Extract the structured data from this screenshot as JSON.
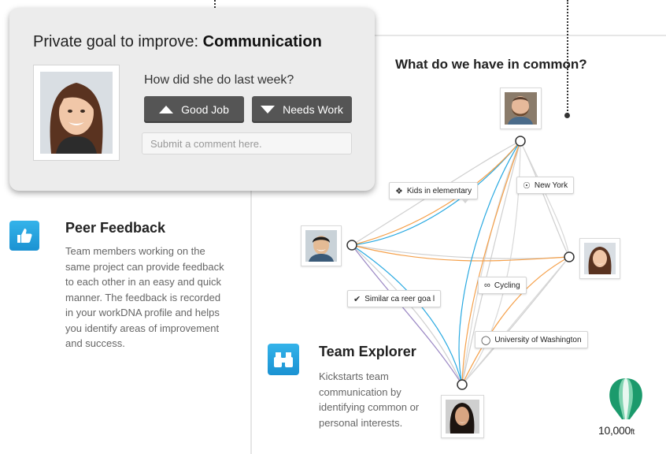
{
  "feedback_card": {
    "title_prefix": "Private goal to improve:",
    "goal": "Communication",
    "question": "How did she do last week?",
    "good_label": "Good Job",
    "needs_label": "Needs Work",
    "comment_placeholder": "Submit a comment here."
  },
  "peer_feedback": {
    "title": "Peer Feedback",
    "description": "Team members working on the same project can provide feedback to each other in an easy and quick manner. The feedback is recorded in your workDNA profile and helps you identify areas of improvement and success."
  },
  "network": {
    "title": "What do we have in common?",
    "tags": {
      "kids": "Kids in elementary",
      "newyork": "New York",
      "cycling": "Cycling",
      "career": "Similar ca reer goa l",
      "uw": "University of Washington"
    }
  },
  "team_explorer": {
    "title": "Team Explorer",
    "description": "Kickstarts team communication by identifying common or personal interests."
  },
  "brand": {
    "name": "10,000",
    "suffix": "ft"
  },
  "colors": {
    "accent_blue": "#29a9e1",
    "button_gray": "#555555",
    "orange": "#f5a04a",
    "purple": "#9b88c4"
  }
}
